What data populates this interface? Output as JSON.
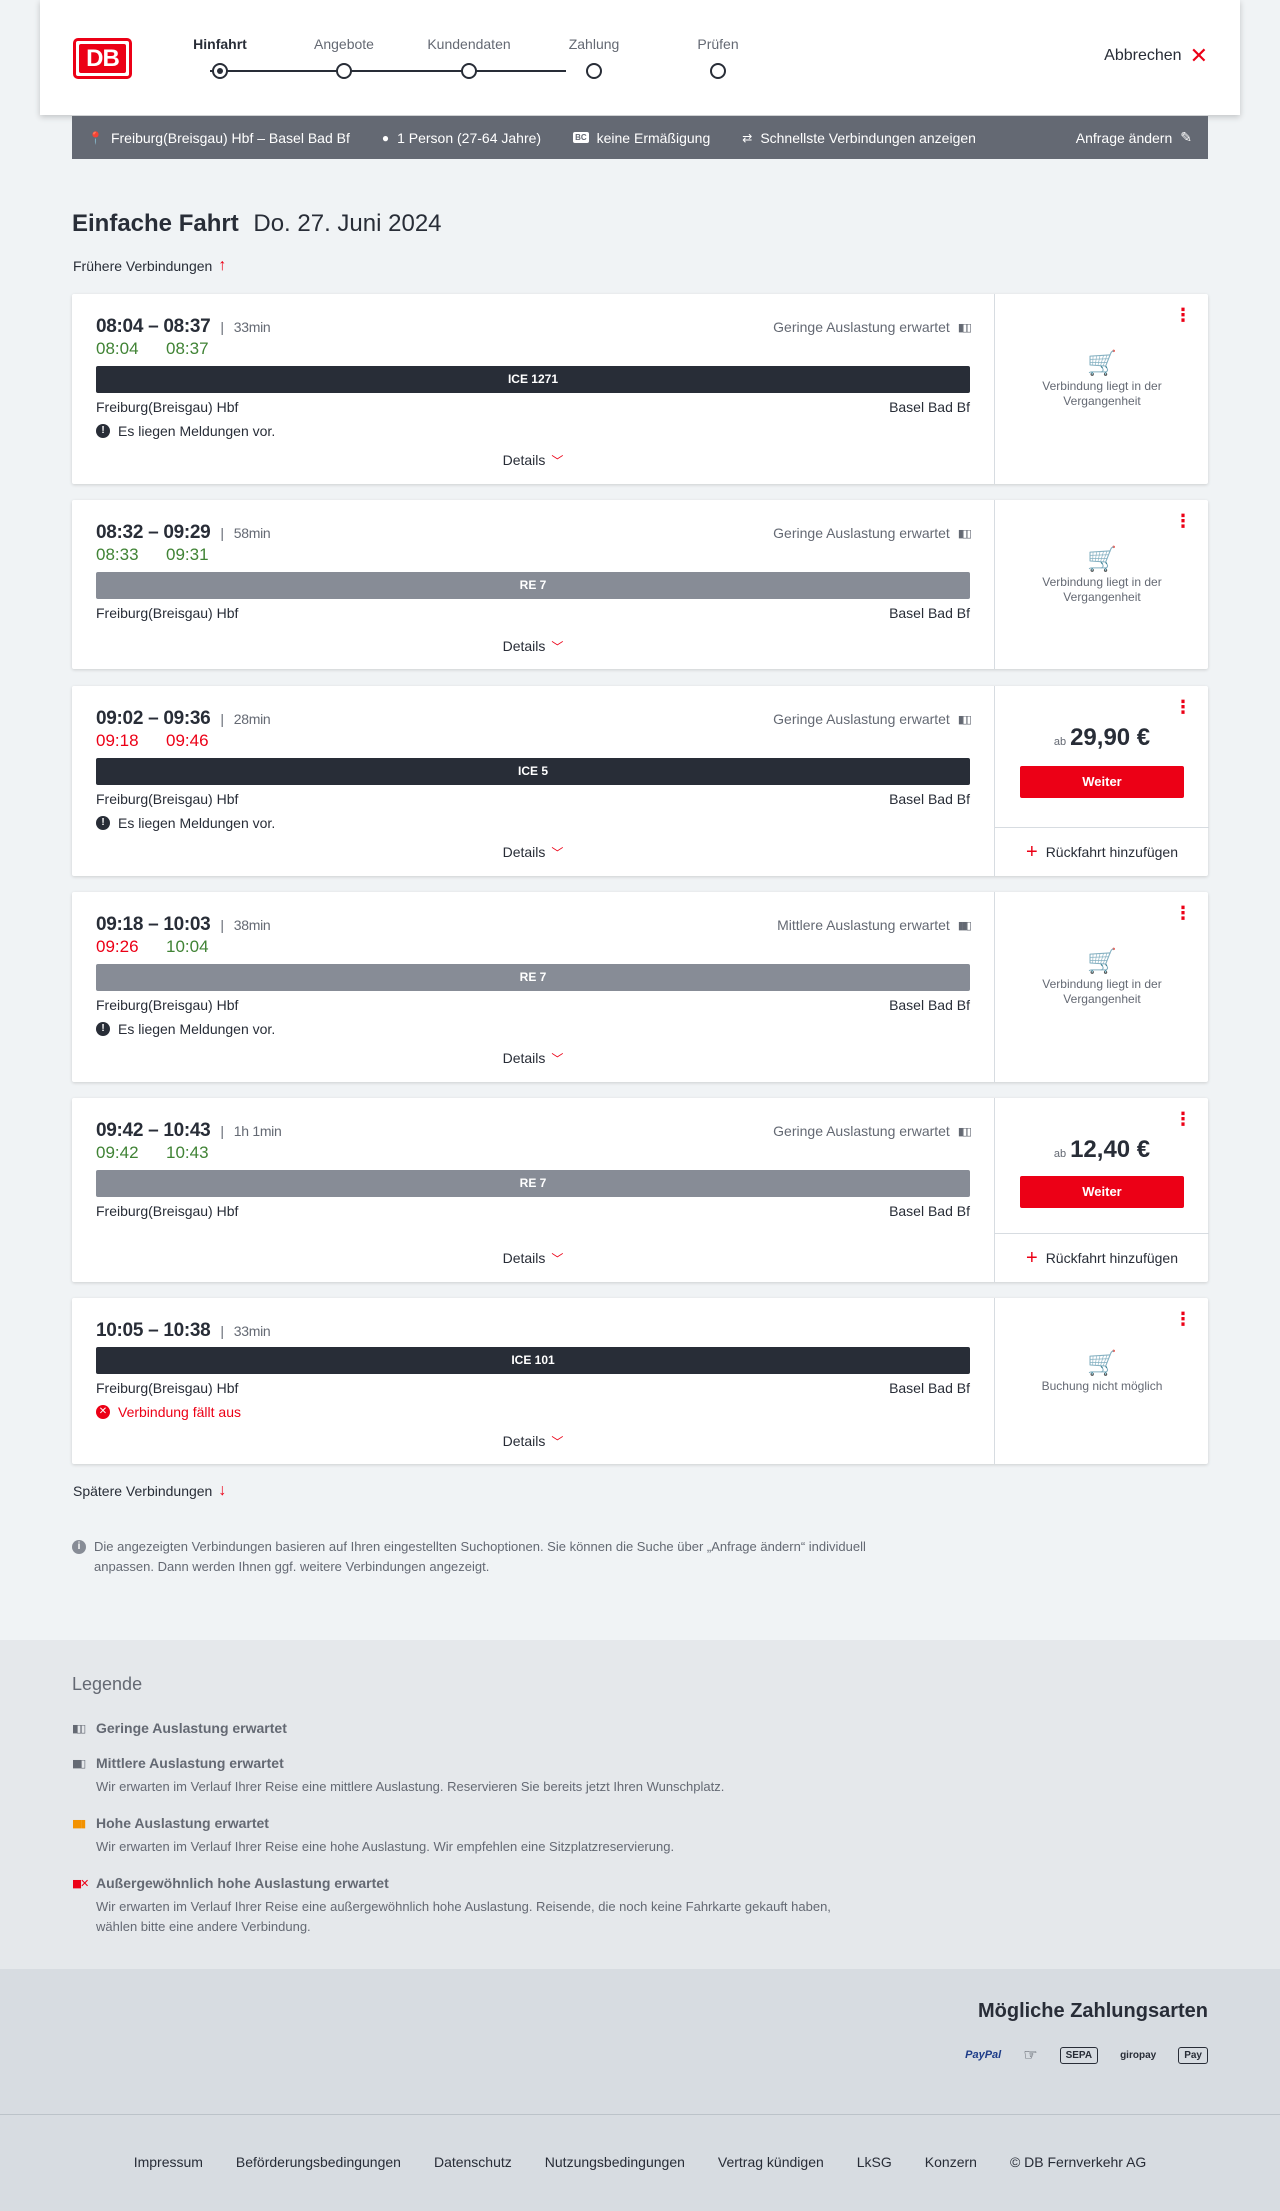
{
  "header": {
    "logo": "DB",
    "steps": [
      {
        "label": "Hinfahrt",
        "active": true
      },
      {
        "label": "Angebote",
        "active": false
      },
      {
        "label": "Kundendaten",
        "active": false
      },
      {
        "label": "Zahlung",
        "active": false
      },
      {
        "label": "Prüfen",
        "active": false
      }
    ],
    "cancel_label": "Abbrechen"
  },
  "query": {
    "route": "Freiburg(Breisgau) Hbf – Basel Bad Bf",
    "persons": "1 Person (27-64 Jahre)",
    "bc_badge": "BC",
    "discount": "keine Ermäßigung",
    "fastest": "Schnellste Verbindungen anzeigen",
    "edit": "Anfrage ändern"
  },
  "title": {
    "type": "Einfache Fahrt",
    "date": "Do. 27. Juni 2024"
  },
  "earlier_label": "Frühere Verbindungen",
  "later_label": "Spätere Verbindungen",
  "connections": [
    {
      "times": "08:04 – 08:37",
      "duration": "33min",
      "rt_dep": "08:04",
      "rt_arr": "08:37",
      "rt_dep_color": "green",
      "rt_arr_color": "green",
      "occupancy": "Geringe Auslastung erwartet",
      "train": "ICE 1271",
      "from": "Freiburg(Breisgau) Hbf",
      "to": "Basel Bad Bf",
      "message": "Es liegen Meldungen vor.",
      "details": "Details",
      "status": "Verbindung liegt in der Vergangenheit"
    },
    {
      "times": "08:32 – 09:29",
      "duration": "58min",
      "rt_dep": "08:33",
      "rt_arr": "09:31",
      "rt_dep_color": "green",
      "rt_arr_color": "green",
      "occupancy": "Geringe Auslastung erwartet",
      "train": "RE 7",
      "from": "Freiburg(Breisgau) Hbf",
      "to": "Basel Bad Bf",
      "details": "Details",
      "status": "Verbindung liegt in der Vergangenheit"
    },
    {
      "times": "09:02 – 09:36",
      "duration": "28min",
      "rt_dep": "09:18",
      "rt_arr": "09:46",
      "rt_dep_color": "red",
      "rt_arr_color": "red",
      "occupancy": "Geringe Auslastung erwartet",
      "train": "ICE 5",
      "from": "Freiburg(Breisgau) Hbf",
      "to": "Basel Bad Bf",
      "message": "Es liegen Meldungen vor.",
      "details": "Details",
      "price_prefix": "ab",
      "price": "29,90 €",
      "cta": "Weiter",
      "return": "Rückfahrt hinzufügen"
    },
    {
      "times": "09:18 – 10:03",
      "duration": "38min",
      "rt_dep": "09:26",
      "rt_arr": "10:04",
      "rt_dep_color": "red",
      "rt_arr_color": "green",
      "occupancy": "Mittlere Auslastung erwartet",
      "train": "RE 7",
      "from": "Freiburg(Breisgau) Hbf",
      "to": "Basel Bad Bf",
      "message": "Es liegen Meldungen vor.",
      "details": "Details",
      "status": "Verbindung liegt in der Vergangenheit"
    },
    {
      "times": "09:42 – 10:43",
      "duration": "1h 1min",
      "rt_dep": "09:42",
      "rt_arr": "10:43",
      "rt_dep_color": "green",
      "rt_arr_color": "green",
      "occupancy": "Geringe Auslastung erwartet",
      "train": "RE 7",
      "from": "Freiburg(Breisgau) Hbf",
      "to": "Basel Bad Bf",
      "details": "Details",
      "price_prefix": "ab",
      "price": "12,40 €",
      "cta": "Weiter",
      "return": "Rückfahrt hinzufügen"
    },
    {
      "times": "10:05 – 10:38",
      "duration": "33min",
      "train": "ICE 101",
      "from": "Freiburg(Breisgau) Hbf",
      "to": "Basel Bad Bf",
      "cancelled": "Verbindung fällt aus",
      "details": "Details",
      "status": "Buchung nicht möglich"
    }
  ],
  "info_note": "Die angezeigten Verbindungen basieren auf Ihren eingestellten Suchoptionen. Sie können die Suche über „Anfrage ändern“ individuell anpassen. Dann werden Ihnen ggf. weitere Verbindungen angezeigt.",
  "legend": {
    "title": "Legende",
    "items": [
      {
        "head": "Geringe Auslastung erwartet",
        "text": ""
      },
      {
        "head": "Mittlere Auslastung erwartet",
        "text": "Wir erwarten im Verlauf Ihrer Reise eine mittlere Auslastung. Reservieren Sie bereits jetzt Ihren Wunschplatz."
      },
      {
        "head": "Hohe Auslastung erwartet",
        "text": "Wir erwarten im Verlauf Ihrer Reise eine hohe Auslastung. Wir empfehlen eine Sitzplatzreservierung."
      },
      {
        "head": "Außergewöhnlich hohe Auslastung erwartet",
        "text": "Wir erwarten im Verlauf Ihrer Reise eine außergewöhnlich hohe Auslastung. Reisende, die noch keine Fahrkarte gekauft haben, wählen bitte eine andere Verbindung."
      }
    ]
  },
  "payment": {
    "title": "Mögliche Zahlungsarten",
    "methods": [
      "PayPal",
      "SEPA",
      "giropay",
      "Pay"
    ]
  },
  "footer": {
    "links": [
      "Impressum",
      "Beförderungsbedingungen",
      "Datenschutz",
      "Nutzungsbedingungen",
      "Vertrag kündigen",
      "LkSG",
      "Konzern",
      "© DB Fernverkehr AG"
    ]
  },
  "colors": {
    "brand_red": "#ec0016",
    "dark": "#282d37",
    "grey_bar": "#646973",
    "green": "#408335"
  }
}
